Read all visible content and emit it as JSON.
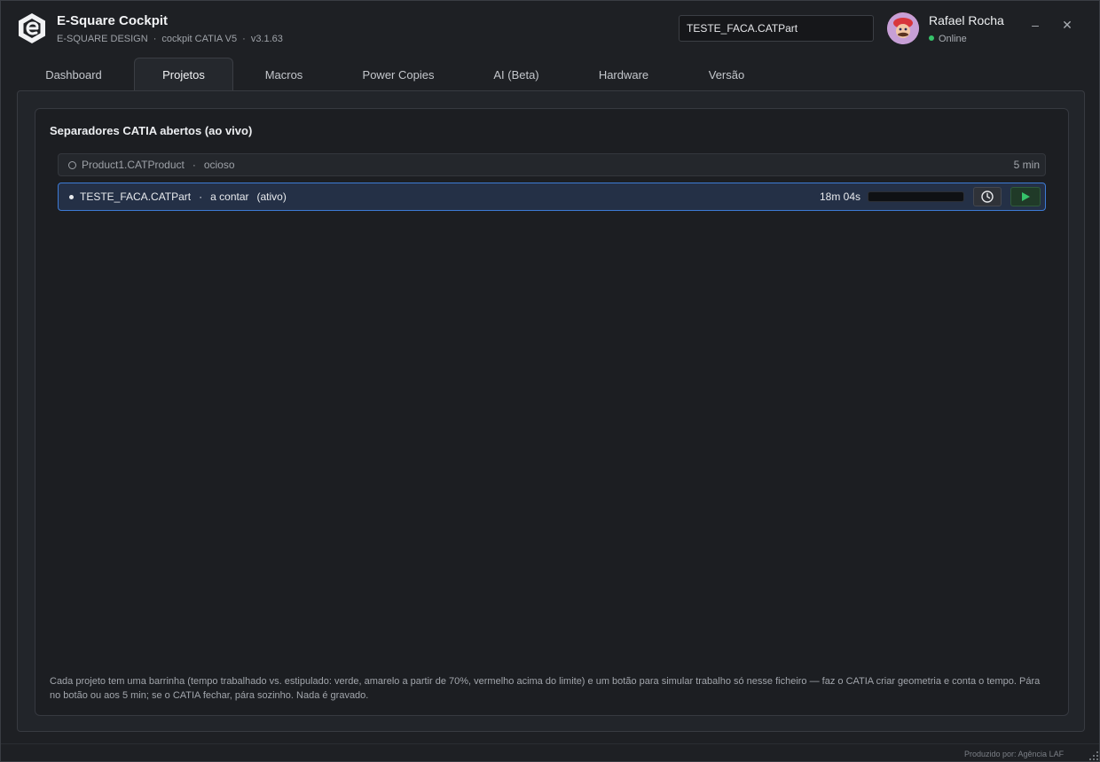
{
  "app": {
    "title": "E-Square Cockpit",
    "subtitle_brand": "E-SQUARE DESIGN",
    "subtitle_product": "cockpit CATIA V5",
    "subtitle_version": "v3.1.63",
    "subtitle_sep": "·"
  },
  "search": {
    "value": "TESTE_FACA.CATPart"
  },
  "user": {
    "name": "Rafael Rocha",
    "status": "Online",
    "status_color": "#36c26a"
  },
  "window_controls": {
    "minimize": "–",
    "close": "✕"
  },
  "tabs": [
    {
      "label": "Dashboard"
    },
    {
      "label": "Projetos"
    },
    {
      "label": "Macros"
    },
    {
      "label": "Power Copies"
    },
    {
      "label": "AI (Beta)"
    },
    {
      "label": "Hardware"
    },
    {
      "label": "Versão"
    }
  ],
  "active_tab": "Projetos",
  "panel": {
    "title": "Separadores CATIA abertos (ao vivo)",
    "rows": [
      {
        "name": "Product1.CATProduct",
        "state": "ocioso",
        "extra": "",
        "time": "5 min",
        "active": false
      },
      {
        "name": "TESTE_FACA.CATPart",
        "state": "a contar",
        "extra": "(ativo)",
        "time": "18m 04s",
        "active": true,
        "progress": 0.0
      }
    ],
    "row_sep": "·",
    "note": "Cada projeto tem uma barrinha (tempo trabalhado vs. estipulado: verde, amarelo a partir de 70%, vermelho acima do limite) e um botão para simular trabalho só nesse ficheiro — faz o CATIA criar geometria e conta o tempo. Pára no botão ou aos 5 min; se o CATIA fechar, pára sozinho. Nada é gravado."
  },
  "credit": "Produzido por: Agência LAF",
  "colors": {
    "accent": "#3d7bd6",
    "play": "#36c26a",
    "progress_green": "#2fa356"
  }
}
